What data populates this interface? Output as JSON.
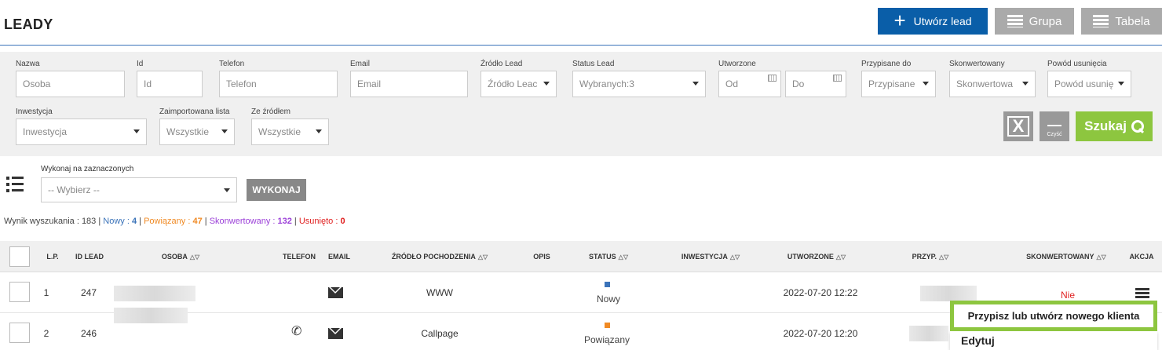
{
  "header": {
    "title": "LEADY",
    "create_label": "Utwórz lead",
    "group_label": "Grupa",
    "table_label": "Tabela"
  },
  "filters": {
    "nazwa": {
      "label": "Nazwa",
      "placeholder": "Osoba"
    },
    "id": {
      "label": "Id",
      "placeholder": "Id"
    },
    "telefon": {
      "label": "Telefon",
      "placeholder": "Telefon"
    },
    "email": {
      "label": "Email",
      "placeholder": "Email"
    },
    "zrodlo": {
      "label": "Źródło Lead",
      "value": "Źródło Leac"
    },
    "status": {
      "label": "Status Lead",
      "value": "Wybranych:3"
    },
    "utworzone": {
      "label": "Utworzone",
      "from": "Od",
      "to": "Do"
    },
    "przypisane": {
      "label": "Przypisane do",
      "value": "Przypisane"
    },
    "skonwertowany": {
      "label": "Skonwertowany",
      "value": "Skonwertowa"
    },
    "powod": {
      "label": "Powód usunięcia",
      "value": "Powód usunię"
    },
    "inwestycja": {
      "label": "Inwestycja",
      "value": "Inwestycja"
    },
    "zaimportowana": {
      "label": "Zaimportowana lista",
      "value": "Wszystkie"
    },
    "ze_zrodlem": {
      "label": "Ze źródłem",
      "value": "Wszystkie"
    },
    "clear_label": "Czyść",
    "search_label": "Szukaj"
  },
  "bulk": {
    "label": "Wykonaj na zaznaczonych",
    "placeholder": "-- Wybierz --",
    "run_label": "WYKONAJ"
  },
  "summary": {
    "prefix": "Wynik wyszukania : ",
    "total": "183",
    "sep": " | ",
    "new_label": "Nowy : ",
    "new_count": "4",
    "linked_label": "Powiązany : ",
    "linked_count": "47",
    "converted_label": "Skonwertowany : ",
    "converted_count": "132",
    "deleted_label": "Usunięto : ",
    "deleted_count": "0"
  },
  "table": {
    "columns": [
      "L.P.",
      "ID LEAD",
      "OSOBA",
      "TELEFON",
      "EMAIL",
      "ŹRÓDŁO POCHODZENIA",
      "OPIS",
      "STATUS",
      "INWESTYCJA",
      "UTWORZONE",
      "PRZYP.",
      "SKONWERTOWANY",
      "AKCJA"
    ],
    "rows": [
      {
        "lp": "1",
        "id": "247",
        "source": "WWW",
        "status": "Nowy",
        "status_color": "#3b73b9",
        "created": "2022-07-20 12:22",
        "converted": "Nie"
      },
      {
        "lp": "2",
        "id": "246",
        "source": "Callpage",
        "status": "Powiązany",
        "status_color": "#f08a24",
        "created": "2022-07-20 12:20"
      }
    ]
  },
  "tooltip": {
    "text": "Przypisz lub utwórz nowego klienta",
    "menu_item": "Edytuj"
  }
}
